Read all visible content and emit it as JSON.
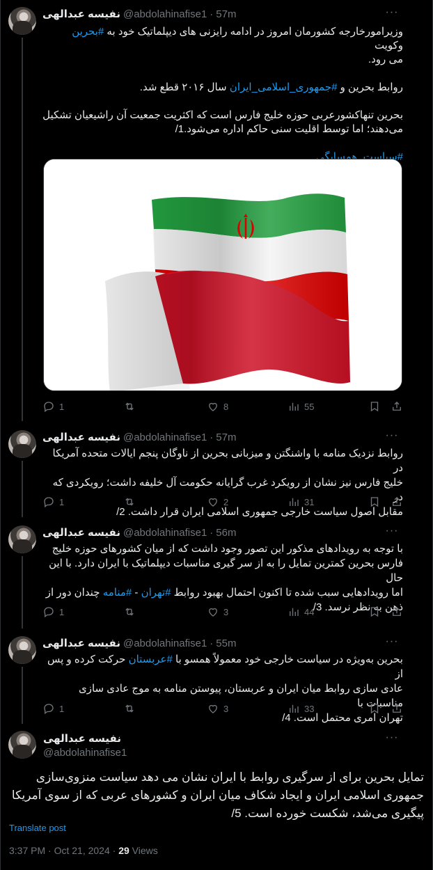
{
  "author": {
    "name": "نفیسه عبدالهی",
    "handle": "@abdolahinafise1"
  },
  "more_label": "···",
  "tweets": [
    {
      "time": "57m",
      "lines": [
        [
          "وزیرامورخارجه کشورمان امروز در ادامه رایزنی های دیپلماتیک خود به ",
          "#بحرین",
          " وکویت"
        ],
        [
          "می رود."
        ],
        [
          ""
        ],
        [
          "روابط بحرین و ",
          "#جمهوری_اسلامی_ایران",
          " سال ۲۰۱۶ قطع شد."
        ],
        [
          ""
        ],
        [
          "بحرین تنهاکشورعربی حوزه خلیج فارس است که اکثریت جمعیت آن راشیعیان تشکیل"
        ],
        [
          "می‌دهند؛ اما توسط اقلیت سنی حاکم اداره می‌شود.1/"
        ],
        [
          ""
        ],
        [
          "",
          "#سیاست_همسایگی",
          ""
        ]
      ],
      "replies": "1",
      "reposts": "",
      "likes": "8",
      "views": "55"
    },
    {
      "time": "57m",
      "lines": [
        [
          "روابط نزدیک منامه با واشنگتن و میزبانی بحرین از ناوگان پنجم ایالات متحده آمریکا در"
        ],
        [
          "خلیج فارس نیز نشان از رویکرد غرب گرایانه حکومت آل خلیفه داشت؛ رویکردی که در"
        ],
        [
          "مقابل اصول سیاست خارجی جمهوری اسلامی ایران قرار داشت. 2/"
        ]
      ],
      "replies": "1",
      "reposts": "",
      "likes": "2",
      "views": "31"
    },
    {
      "time": "56m",
      "lines": [
        [
          "با توجه به رویدادهای مذکور این تصور وجود داشت که از میان کشورهای حوزه خلیج"
        ],
        [
          "فارس بحرین کمترین تمایل را به از سر گیری مناسبات دیپلماتیک با ایران دارد. با این حال"
        ],
        [
          "اما رویدادهایی سبب شده تا اکنون احتمال بهبود روابط ",
          "#تهران",
          " - ",
          "#منامه",
          " چندان دور از"
        ],
        [
          "ذهن به نظر نرسد. 3/"
        ]
      ],
      "replies": "1",
      "reposts": "",
      "likes": "3",
      "views": "44"
    },
    {
      "time": "55m",
      "lines": [
        [
          "بحرین به‌ویژه در سیاست خارجی خود معمولاً همسو با ",
          "#عربستان",
          " حرکت کرده و پس از"
        ],
        [
          "عادی سازی روابط میان ایران و عربستان، پیوستن منامه به موج عادی سازی مناسبات با"
        ],
        [
          "تهران امری محتمل است. 4/"
        ]
      ],
      "replies": "1",
      "reposts": "",
      "likes": "3",
      "views": "33"
    }
  ],
  "main_tweet": {
    "lines": [
      "تمایل بحرین برای از سرگیری روابط با ایران نشان می دهد سیاست منزوی‌سازی",
      "جمهوری اسلامی ایران و ایجاد شکاف میان ایران و کشورهای عربی که از سوی آمریکا",
      "پیگیری می‌شد، شکست خورده است. 5/"
    ],
    "translate_label": "Translate post",
    "timestamp": "3:37 PM · Oct 21, 2024 · ",
    "views_count": "29",
    "views_label": " Views"
  },
  "colors": {
    "background": "#000000",
    "text": "#e7e9ea",
    "muted": "#71767b",
    "link": "#1d9bf0",
    "flag_green": "#239f40",
    "flag_red": "#da0000",
    "bahrain_red": "#ce1126"
  }
}
